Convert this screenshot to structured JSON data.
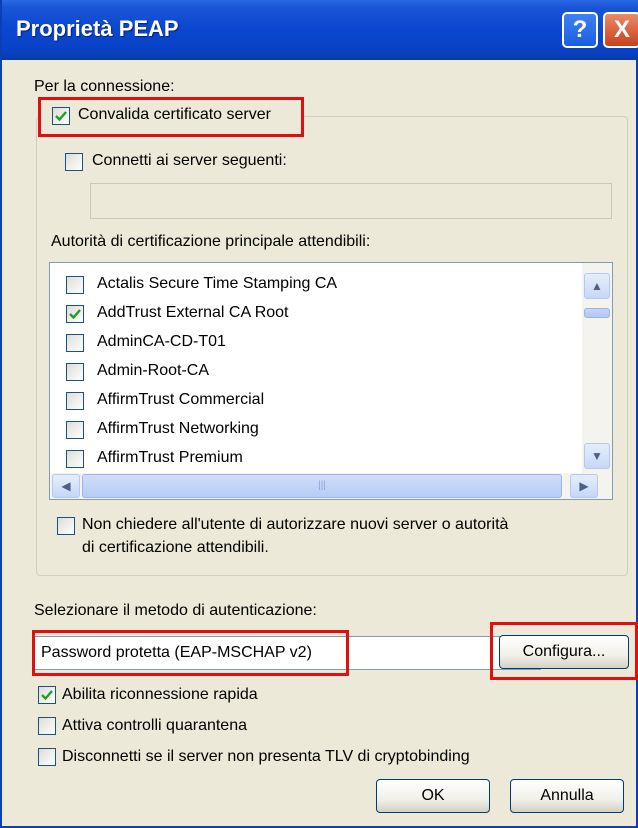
{
  "window": {
    "title": "Proprietà PEAP",
    "help_label": "?",
    "close_label": "X"
  },
  "connection": {
    "label": "Per la connessione:",
    "validate_cert": {
      "label": "Convalida certificato server",
      "checked": true
    },
    "connect_servers": {
      "label": "Connetti ai server seguenti:",
      "checked": false,
      "value": ""
    },
    "ca_label": "Autorità di certificazione principale attendibili:",
    "ca_list": [
      {
        "label": "Actalis Secure Time Stamping CA",
        "checked": false
      },
      {
        "label": "AddTrust External CA Root",
        "checked": true
      },
      {
        "label": "AdminCA-CD-T01",
        "checked": false
      },
      {
        "label": "Admin-Root-CA",
        "checked": false
      },
      {
        "label": "AffirmTrust Commercial",
        "checked": false
      },
      {
        "label": "AffirmTrust Networking",
        "checked": false
      },
      {
        "label": "AffirmTrust Premium",
        "checked": false
      }
    ],
    "no_prompt": {
      "line1": "Non chiedere all'utente di autorizzare nuovi server o autorità",
      "line2": "di certificazione attendibili.",
      "checked": false
    }
  },
  "auth": {
    "label": "Selezionare il metodo di autenticazione:",
    "method_value": "Password protetta (EAP-MSCHAP v2)",
    "configure_label": "Configura..."
  },
  "options": [
    {
      "label": "Abilita riconnessione rapida",
      "checked": true
    },
    {
      "label": "Attiva controlli quarantena",
      "checked": false
    },
    {
      "label": "Disconnetti se il server non presenta TLV di cryptobinding",
      "checked": false
    }
  ],
  "buttons": {
    "ok": "OK",
    "cancel": "Annulla"
  },
  "colors": {
    "titlebar": "#0a46cf",
    "dialog_bg": "#ece9d8",
    "highlight_red": "#e11010",
    "check": "#21a121"
  }
}
